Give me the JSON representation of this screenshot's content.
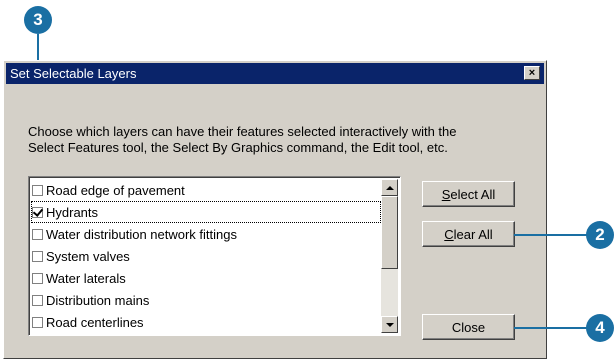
{
  "dialog": {
    "title": "Set Selectable Layers",
    "close_glyph": "×",
    "instructions_line1": "Choose which layers can have their features selected interactively with the",
    "instructions_line2": "Select Features tool, the Select By Graphics command, the Edit tool, etc."
  },
  "layers": [
    {
      "label": "Road  edge of pavement",
      "checked": false
    },
    {
      "label": "Hydrants",
      "checked": true
    },
    {
      "label": "Water distribution network fittings",
      "checked": false
    },
    {
      "label": "System valves",
      "checked": false
    },
    {
      "label": "Water laterals",
      "checked": false
    },
    {
      "label": "Distribution mains",
      "checked": false
    },
    {
      "label": "Road centerlines",
      "checked": false
    }
  ],
  "buttons": {
    "select_all": {
      "mnemonic": "S",
      "rest": "elect All"
    },
    "clear_all": {
      "mnemonic": "C",
      "rest": "lear All"
    },
    "close": "Close"
  },
  "callouts": {
    "step3": "3",
    "step2": "2",
    "step4": "4"
  },
  "colors": {
    "callout": "#1a6fa3",
    "titlebar": "#0a246a",
    "dialog_face": "#d4d0c8"
  }
}
